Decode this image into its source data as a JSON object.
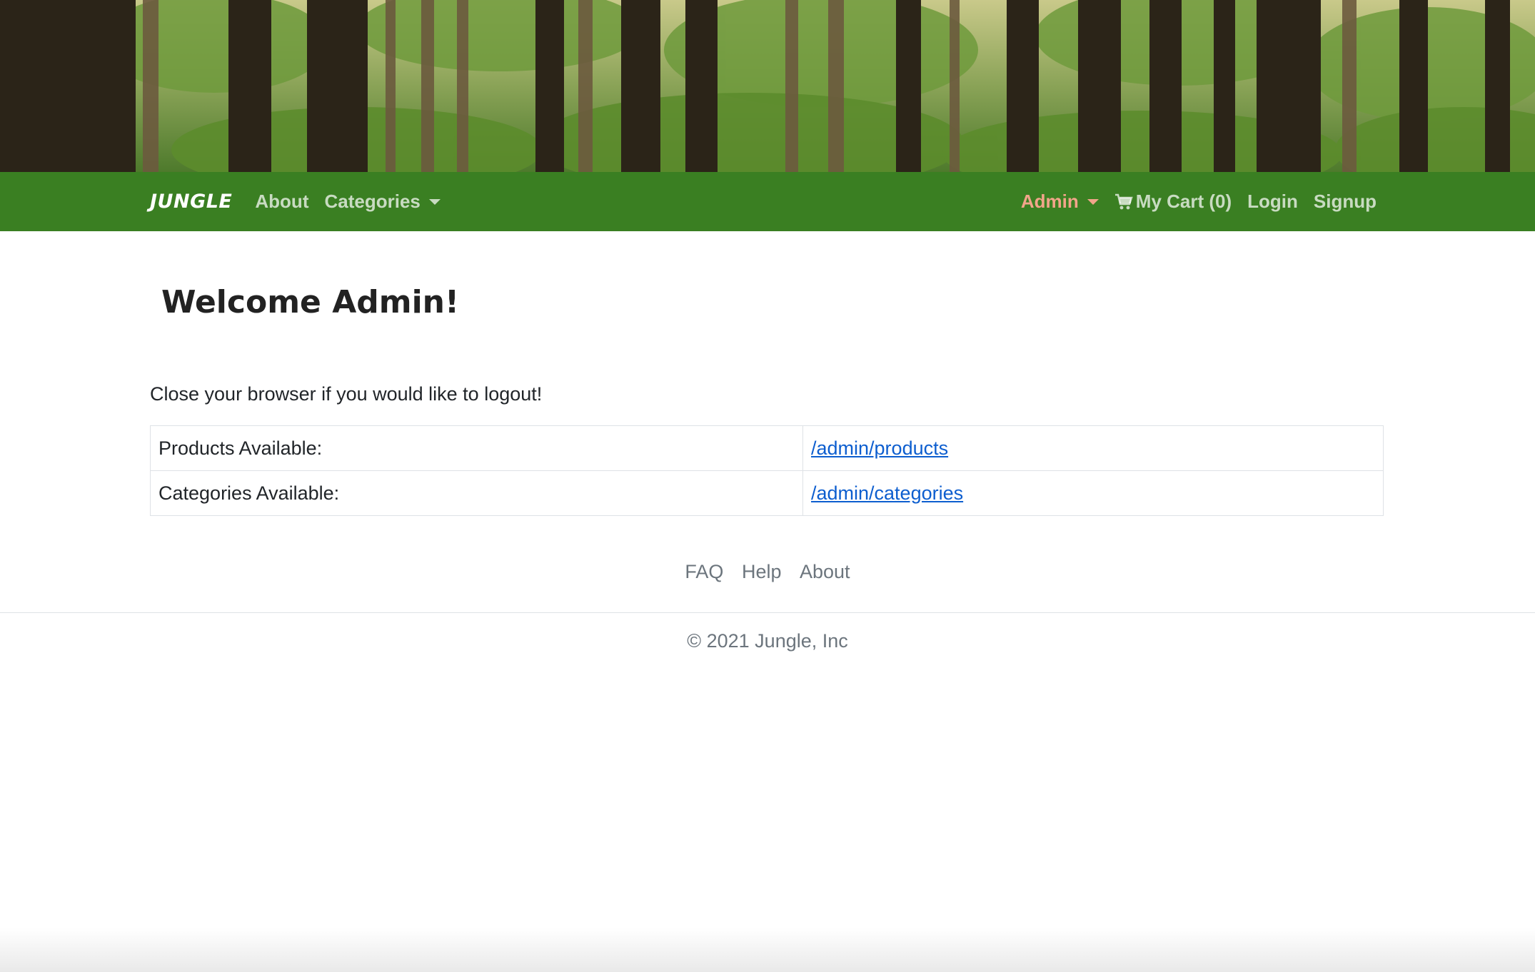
{
  "hero": {
    "image": "forest-banner"
  },
  "navbar": {
    "brand": "JUNGLE",
    "about": "About",
    "categories": "Categories",
    "admin": "Admin",
    "cart_icon": "shopping-cart-icon",
    "cart": "My Cart (0)",
    "login": "Login",
    "signup": "Signup"
  },
  "main": {
    "title": "Welcome Admin!",
    "logout_note": "Close your browser if you would like to logout!",
    "rows": [
      {
        "label": "Products Available:",
        "link": "/admin/products"
      },
      {
        "label": "Categories Available:",
        "link": "/admin/categories"
      }
    ]
  },
  "footer": {
    "links": [
      "FAQ",
      "Help",
      "About"
    ],
    "copyright": "© 2021 Jungle, Inc"
  },
  "colors": {
    "navbar": "#3a7f22",
    "admin_link": "#f2a58a",
    "link": "#0d5ecf"
  }
}
